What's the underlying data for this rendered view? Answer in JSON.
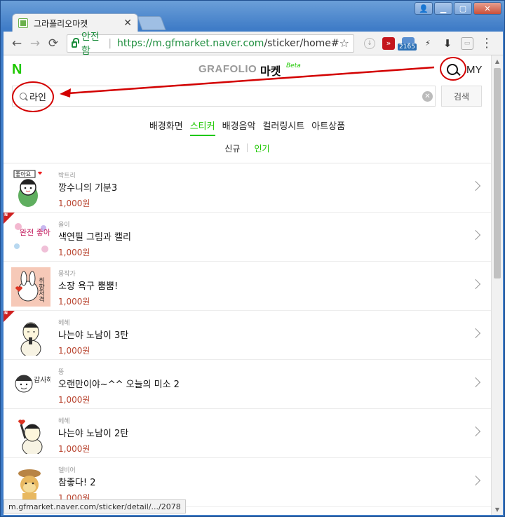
{
  "browser": {
    "tab_title": "그라폴리오마켓",
    "url_secure_label": "안전함",
    "url_host": "https://m.gfmarket.naver.com",
    "url_path": "/sticker/home#",
    "extension_badge": "2165",
    "status_url": "m.gfmarket.naver.com/sticker/detail/.../2078"
  },
  "header": {
    "logo": "N",
    "brand": "GRAFOLIO",
    "market": "마켓",
    "beta": "Beta",
    "my": "MY"
  },
  "search": {
    "value": "라인",
    "button": "검색"
  },
  "categories": [
    {
      "label": "배경화면",
      "active": false
    },
    {
      "label": "스티커",
      "active": true
    },
    {
      "label": "배경음악",
      "active": false
    },
    {
      "label": "컬러링시트",
      "active": false
    },
    {
      "label": "아트상품",
      "active": false
    }
  ],
  "sub_tabs": {
    "new": "신규",
    "popular": "인기"
  },
  "items": [
    {
      "author": "박트리",
      "title": "깡수니의 기분3",
      "price": "1,000원",
      "is_new": false
    },
    {
      "author": "율이",
      "title": "색연필 그림과 캘리",
      "price": "1,000원",
      "is_new": true
    },
    {
      "author": "뭉작가",
      "title": "소장 욕구 뿜뿜!",
      "price": "1,000원",
      "is_new": false
    },
    {
      "author": "헤헤",
      "title": "나는야 노남이 3탄",
      "price": "1,000원",
      "is_new": true
    },
    {
      "author": "뚱",
      "title": "오랜만이야~^^ 오늘의 미소 2",
      "price": "1,000원",
      "is_new": false
    },
    {
      "author": "헤헤",
      "title": "나는야 노남이 2탄",
      "price": "1,000원",
      "is_new": false
    },
    {
      "author": "델비어",
      "title": "참좋다! 2",
      "price": "1,000원",
      "is_new": false
    }
  ],
  "thumb_text": {
    "item1": "좋아요",
    "item2": "완전 좋아요",
    "item3": "취향저격",
    "item5": "감사해요"
  },
  "colors": {
    "brand_green": "#1ec800",
    "price_red": "#b8432e",
    "annotation_red": "#d30000"
  }
}
